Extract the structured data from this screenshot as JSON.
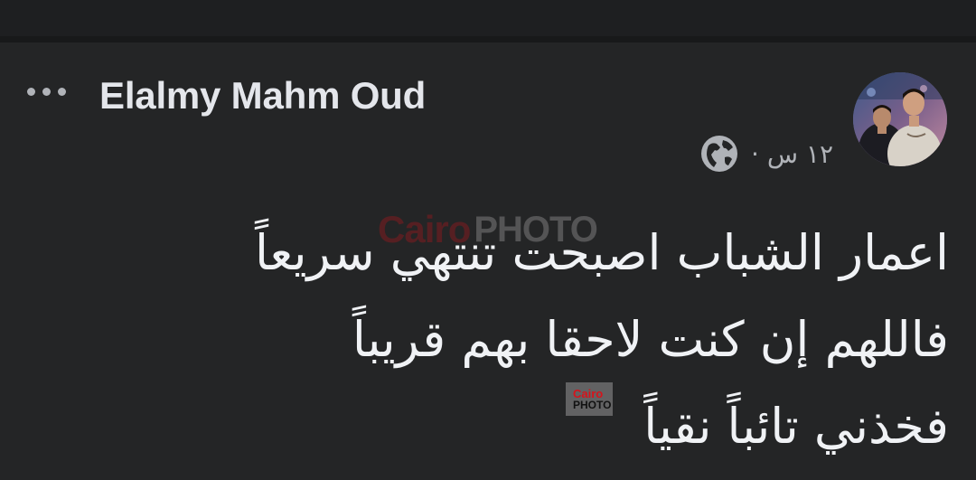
{
  "post": {
    "author": "Elalmy Mahm Oud",
    "time": "١٢ س ·",
    "privacy_icon": "globe-icon",
    "lines": [
      "اعمار الشباب اصبحت تنتهي سريعاً",
      "فاللهم إن كنت لاحقا بهم قريباً",
      "فخذني تائباً نقياً"
    ]
  },
  "watermark": {
    "brand_word": "Cairo",
    "photo_word": "PHOTO"
  },
  "colors": {
    "background": "#242526",
    "text": "#e4e6eb",
    "secondary": "#b0b3b8",
    "watermark_red": "#d6131b"
  }
}
